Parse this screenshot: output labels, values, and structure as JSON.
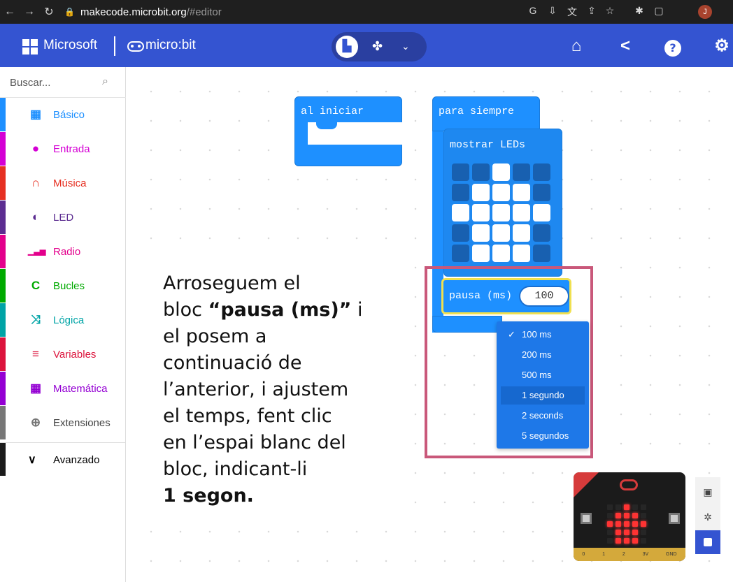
{
  "browser": {
    "url_host": "makecode.microbit.org",
    "url_path": "/#editor",
    "profile_initial": "J"
  },
  "header": {
    "brand": "Microsoft",
    "product": "micro:bit"
  },
  "toolbox": {
    "search_placeholder": "Buscar...",
    "categories": [
      {
        "label": "Básico",
        "color": "#1e90ff",
        "icon": "grid-icon"
      },
      {
        "label": "Entrada",
        "color": "#d400d4",
        "icon": "target-icon"
      },
      {
        "label": "Música",
        "color": "#e63022",
        "icon": "headphones-icon"
      },
      {
        "label": "LED",
        "color": "#5c2d91",
        "icon": "toggle-icon"
      },
      {
        "label": "Radio",
        "color": "#e3008c",
        "icon": "signal-icon"
      },
      {
        "label": "Bucles",
        "color": "#00aa00",
        "icon": "loop-icon"
      },
      {
        "label": "Lógica",
        "color": "#00a4a6",
        "icon": "shuffle-icon"
      },
      {
        "label": "Variables",
        "color": "#dc143c",
        "icon": "lines-icon"
      },
      {
        "label": "Matemática",
        "color": "#9400d3",
        "icon": "calculator-icon"
      },
      {
        "label": "Extensiones",
        "color": "#777777",
        "icon": "plus-circle-icon"
      }
    ],
    "advanced_label": "Avanzado"
  },
  "blocks": {
    "on_start": "al iniciar",
    "forever": "para siempre",
    "show_leds": "mostrar LEDs",
    "pause_label": "pausa (ms)",
    "pause_value": "100",
    "leds": [
      [
        0,
        0,
        1,
        0,
        0
      ],
      [
        0,
        1,
        1,
        1,
        0
      ],
      [
        1,
        1,
        1,
        1,
        1
      ],
      [
        0,
        1,
        1,
        1,
        0
      ],
      [
        0,
        1,
        1,
        1,
        0
      ]
    ]
  },
  "dropdown": {
    "options": [
      "100 ms",
      "200 ms",
      "500 ms",
      "1 segundo",
      "2 seconds",
      "5 segundos"
    ],
    "checked_index": 0,
    "highlighted_index": 3
  },
  "annotation": {
    "line1": "Arroseguem el",
    "line2_pre": "bloc ",
    "line2_bold": "“pausa (ms)”",
    "line2_post": " i",
    "line3": "el posem a",
    "line4": "continuació de",
    "line5": "l’anterior, i ajustem",
    "line6": "el temps, fent clic",
    "line7": "en l’espai blanc del",
    "line8": "bloc, indicant-li",
    "line9_bold": "1 segon."
  },
  "simulator": {
    "leds": [
      [
        0,
        0,
        1,
        0,
        0
      ],
      [
        0,
        1,
        1,
        1,
        0
      ],
      [
        1,
        1,
        1,
        1,
        1
      ],
      [
        0,
        1,
        1,
        1,
        0
      ],
      [
        0,
        1,
        1,
        1,
        0
      ]
    ],
    "pins": [
      "0",
      "1",
      "2",
      "3V",
      "GND"
    ]
  },
  "colors": {
    "header_blue": "#3454d1",
    "block_blue": "#1e90ff",
    "highlight_pink": "#c9587a"
  }
}
